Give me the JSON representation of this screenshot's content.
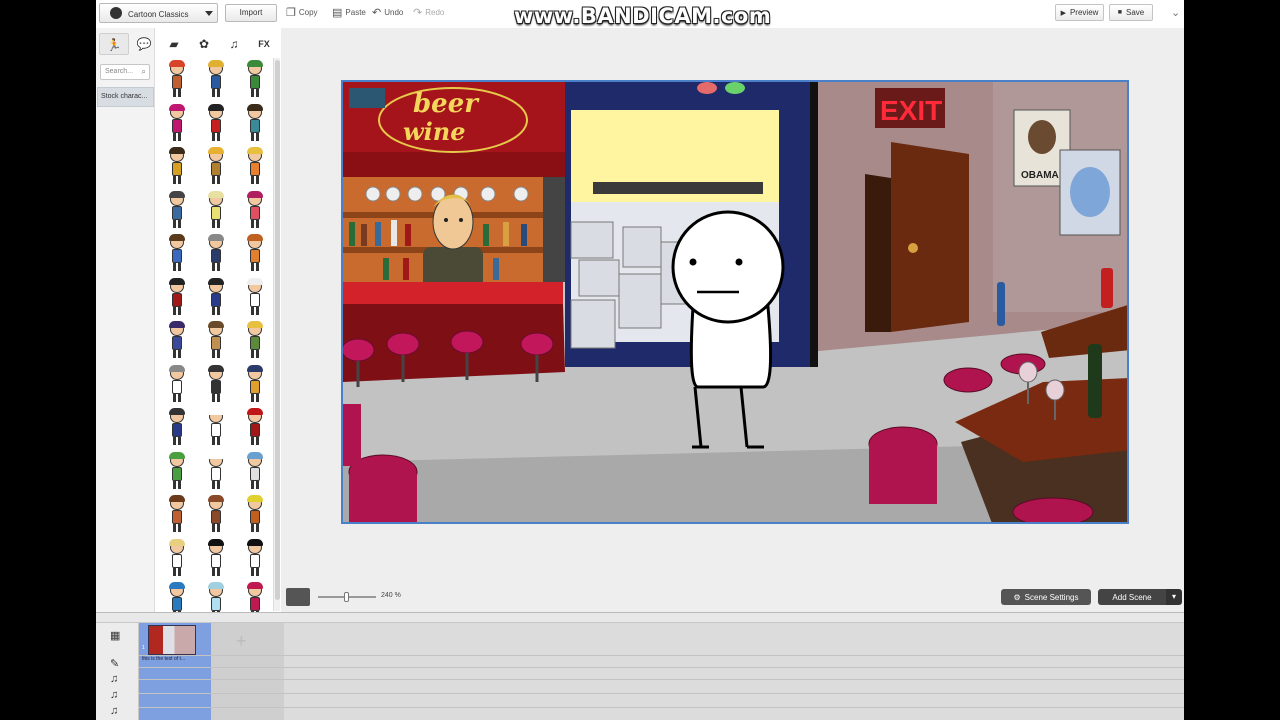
{
  "toolbar": {
    "theme_select": "Cartoon Classics",
    "import_label": "Import",
    "copy_label": "Copy",
    "paste_label": "Paste",
    "undo_label": "Undo",
    "redo_label": "Redo",
    "preview_label": "Preview",
    "save_label": "Save"
  },
  "watermark": "www.BANDICAM.com",
  "panel": {
    "tabs": [
      "character",
      "speech",
      "prop",
      "effects",
      "music",
      "FX"
    ],
    "fx_label": "FX",
    "search_placeholder": "Search...",
    "stock_tab_label": "Stock charac..."
  },
  "stage": {
    "sign_text_1": "beer",
    "sign_text_2": "wine",
    "exit_text": "EXIT",
    "poster_text": "OBAMA"
  },
  "bottom": {
    "zoom_level": "240 %",
    "zoom_fraction": 0.5,
    "scene_settings_label": "Scene Settings",
    "add_scene_label": "Add Scene"
  },
  "timeline": {
    "scene_caption": "this is the test of t...",
    "scene_number": "1"
  }
}
